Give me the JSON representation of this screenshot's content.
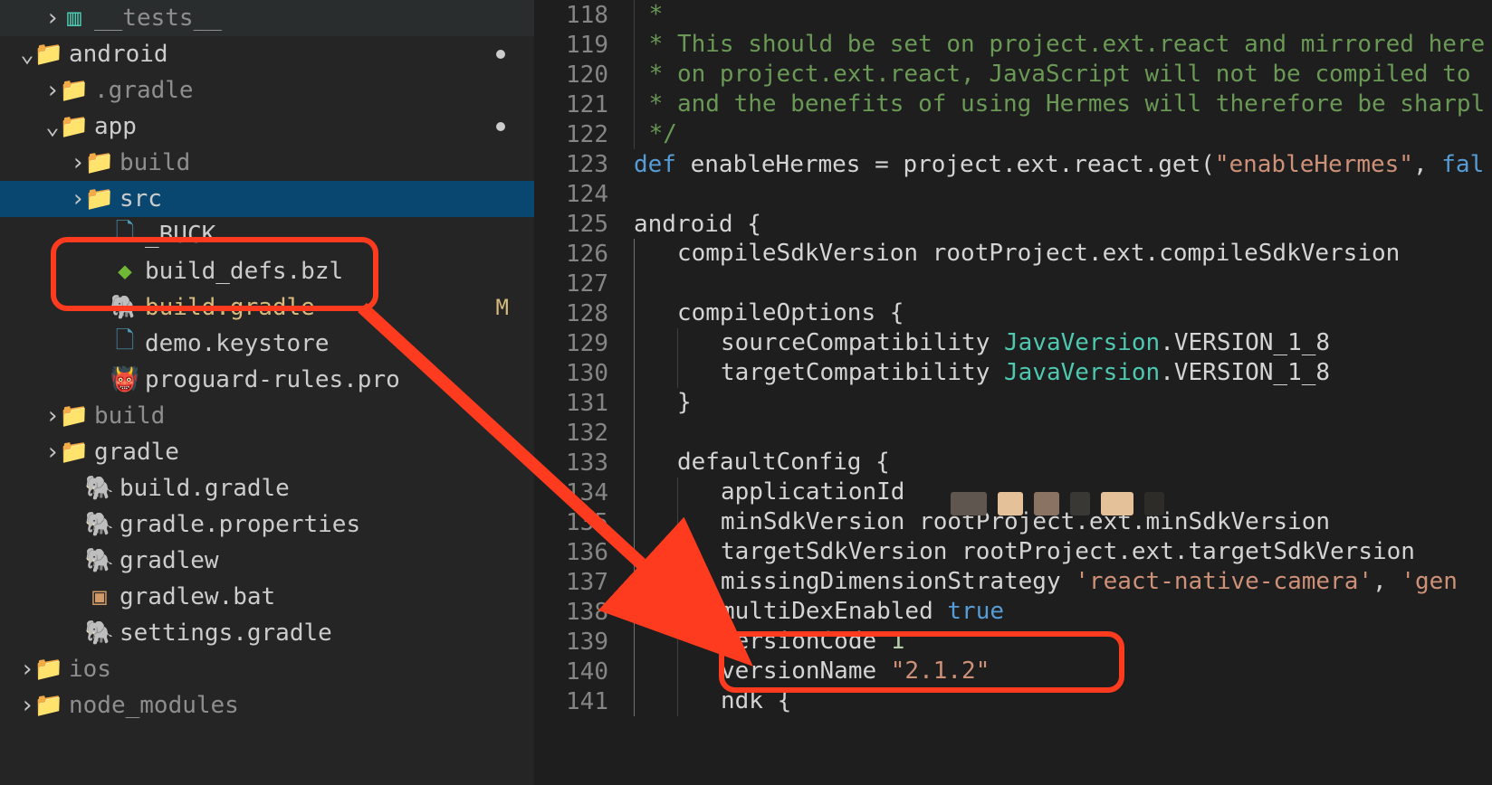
{
  "tree": {
    "tests": "__tests__",
    "android": "android",
    "gradle_dot": ".gradle",
    "app": "app",
    "build_app": "build",
    "src": "src",
    "buck": "_BUCK",
    "build_defs": "build_defs.bzl",
    "build_gradle_app": "build.gradle",
    "build_gradle_app_m": "M",
    "demo_keystore": "demo.keystore",
    "proguard": "proguard-rules.pro",
    "build_root": "build",
    "gradle_dir": "gradle",
    "build_gradle_root": "build.gradle",
    "gradle_props": "gradle.properties",
    "gradlew": "gradlew",
    "gradlew_bat": "gradlew.bat",
    "settings_gradle": "settings.gradle",
    "ios": "ios",
    "node_modules": "node_modules"
  },
  "gutter": {
    "start": 118,
    "end": 141,
    "highlighted": 140
  },
  "code": {
    "118": " *",
    "119": " * This should be set on project.ext.react and mirrored here",
    "120": " * on project.ext.react, JavaScript will not be compiled to ",
    "121": " * and the benefits of using Hermes will therefore be sharpl",
    "122": " */",
    "123": {
      "def": "def",
      "name": " enableHermes ",
      "eq": "= ",
      "rest": "project.ext.react.get(",
      "str": "\"enableHermes\"",
      "comma": ", ",
      "false": "fal"
    },
    "124": "",
    "125": {
      "a": "android",
      "b": " {"
    },
    "126": {
      "a": "compileSdkVersion ",
      "b": "rootProject.ext.compileSdkVersion"
    },
    "127": "",
    "128": {
      "a": "compileOptions ",
      "b": "{"
    },
    "129": {
      "a": "sourceCompatibility ",
      "b": "JavaVersion",
      "c": ".VERSION_1_8"
    },
    "130": {
      "a": "targetCompatibility ",
      "b": "JavaVersion",
      "c": ".VERSION_1_8"
    },
    "131": "}",
    "132": "",
    "133": {
      "a": "defaultConfig ",
      "b": "{"
    },
    "134": {
      "a": "applicationId"
    },
    "135": {
      "a": "minSdkVersion ",
      "b": "rootProject.ext.minSdkVersion"
    },
    "136": {
      "a": "targetSdkVersion ",
      "b": "rootProject.ext.targetSdkVersion"
    },
    "137": {
      "a": "missingDimensionStrategy ",
      "b": "'react-native-camera'",
      "c": ", ",
      "d": "'gen"
    },
    "138": {
      "a": "multiDexEnabled ",
      "b": "true"
    },
    "139": {
      "a": "versionCode ",
      "b": "1"
    },
    "140": {
      "a": "versionName ",
      "b": "\"2.1.2\""
    },
    "141": {
      "a": "ndk ",
      "b": "{"
    }
  },
  "annotations": {
    "box1": {
      "desc": "highlight on build.gradle file"
    },
    "box2": {
      "desc": "highlight on versionCode / versionName lines"
    },
    "arrow": {
      "desc": "arrow from build.gradle to version lines"
    }
  }
}
